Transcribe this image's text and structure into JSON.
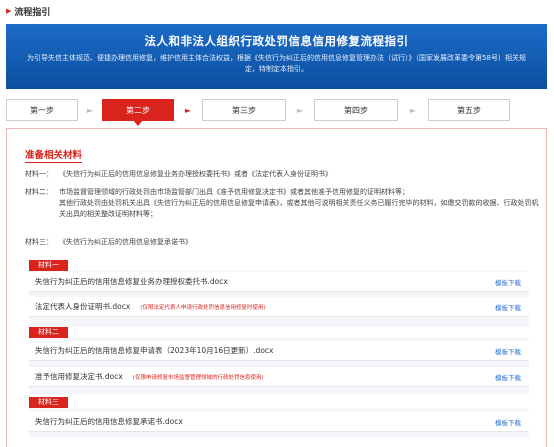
{
  "section": {
    "title": "流程指引"
  },
  "banner": {
    "title": "法人和非法人组织行政处罚信息信用修复流程指引",
    "desc": "为引导失信主体规范、便捷办理信用修复，维护信用主体合法权益，根据《失信行为纠正后的信用信息修复管理办法（试行）》（国家发展改革委令第58号）相关规定，特制定本指引。"
  },
  "steps": [
    "第一步",
    "第二步",
    "第三步",
    "第四步",
    "第五步"
  ],
  "active_step": 1,
  "panel": {
    "title": "准备相关材料",
    "materials": [
      {
        "label": "材料一：",
        "text": "《失信行为纠正后的信用信息修复业务办理授权委托书》或者《法定代表人身份证明书》"
      },
      {
        "label": "材料二：",
        "text": "市场监督管理领域的行政处罚由市场监管部门出具《准予信用修复决定书》或者其他准予信用修复的证明材料等；",
        "text2": "其他行政处罚由处罚机关出具《失信行为纠正后的信用信息修复申请表》，或者其他可说明相关责任义务已履行完毕的材料，如缴交罚款的收据、行政处罚机关出具的相关整改证明材料等；"
      },
      {
        "label": "材料三：",
        "text": "《失信行为纠正后的信用信息修复承诺书》"
      }
    ],
    "groups": [
      {
        "tag": "材料一",
        "files": [
          {
            "name": "失信行为纠正后的信用信息修复业务办理授权委托书.docx",
            "note": "",
            "download": "模板下载"
          },
          {
            "name": "法定代表人身份证明书.docx",
            "note": "(仅限法定代表人申请行政处罚信息信用修复时使用)",
            "download": "模板下载"
          }
        ]
      },
      {
        "tag": "材料二",
        "files": [
          {
            "name": "失信行为纠正后的信用信息修复申请表（2023年10月16日更新）.docx",
            "note": "",
            "download": "模板下载"
          },
          {
            "name": "准予信用修复决定书.docx",
            "note": "(仅限申请修复市场监督管理领域的行政处罚信息使用)",
            "download": "模板下载"
          }
        ]
      },
      {
        "tag": "材料三",
        "files": [
          {
            "name": "失信行为纠正后的信用信息修复承诺书.docx",
            "note": "",
            "download": "模板下载"
          }
        ]
      }
    ]
  },
  "colors": {
    "accent": "#d9241d",
    "banner": "#0b4fa0",
    "link": "#2a6fd0"
  }
}
